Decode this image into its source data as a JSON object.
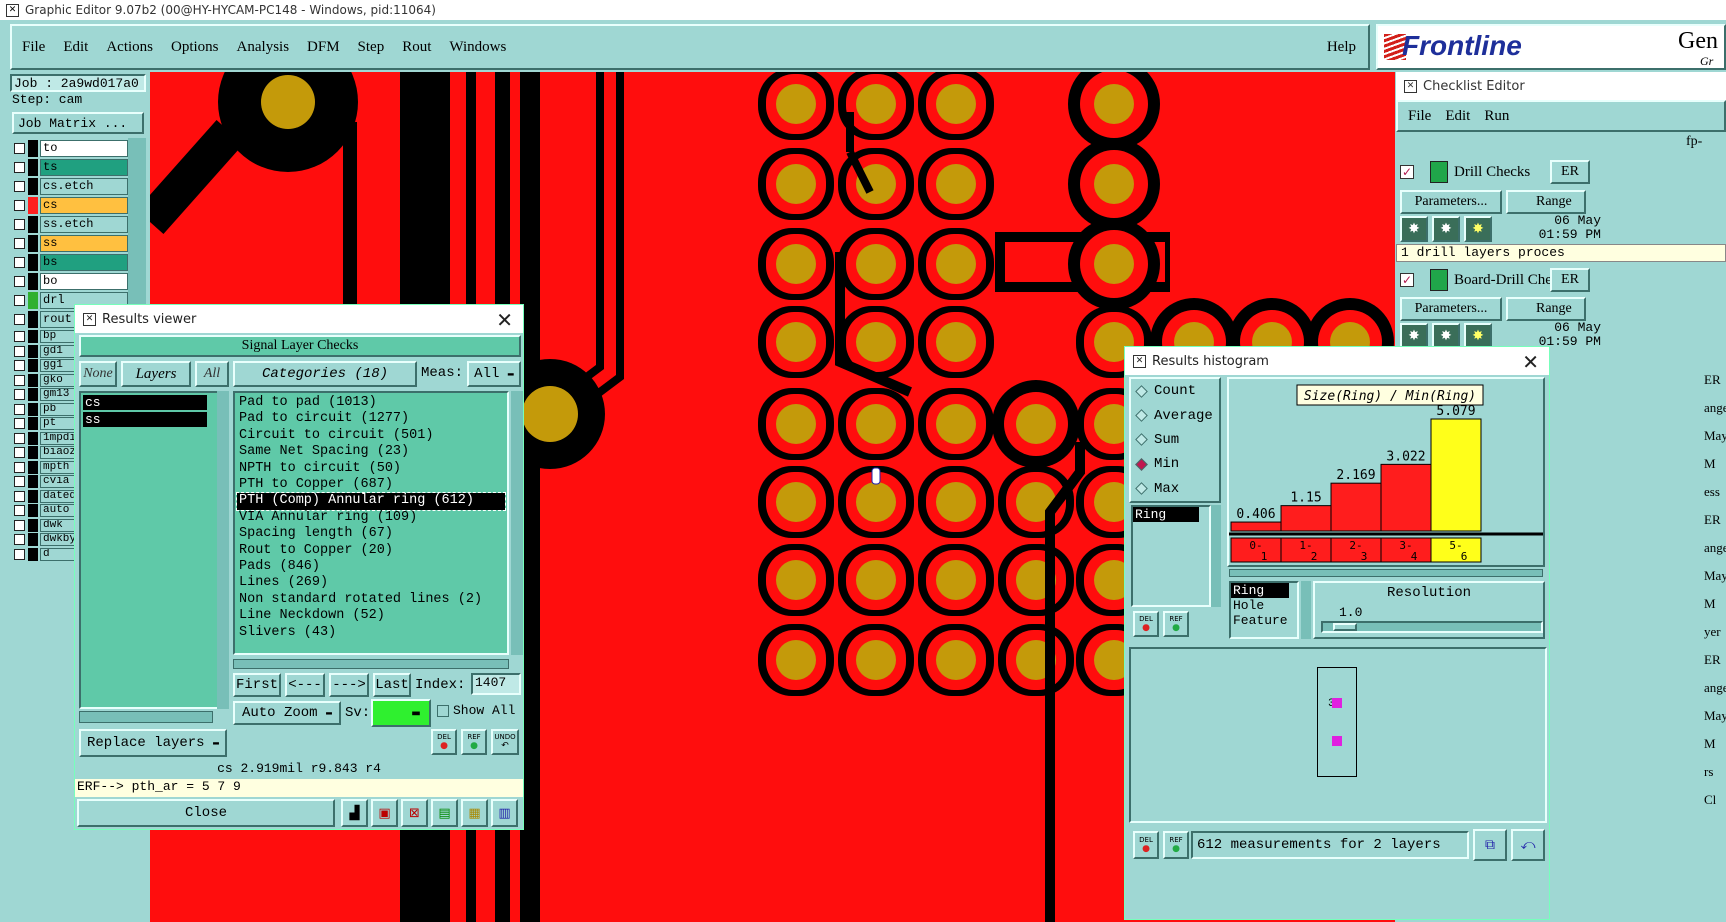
{
  "titlebar": {
    "title": "Graphic Editor 9.07b2 (00@HY-HYCAM-PC148 - Windows, pid:11064)"
  },
  "menu": {
    "items": [
      "File",
      "Edit",
      "Actions",
      "Options",
      "Analysis",
      "DFM",
      "Step",
      "Rout",
      "Windows"
    ],
    "help": "Help"
  },
  "brand": {
    "logo": "Frontline",
    "right_text": "Gen",
    "sub": "Gr"
  },
  "left_panel": {
    "job": "Job : 2a9wd017a0",
    "step": "Step: cam",
    "job_matrix": "Job Matrix ...",
    "layers": [
      "to",
      "ts",
      "cs.etch",
      "cs",
      "ss.etch",
      "ss",
      "bs",
      "bo",
      "drl",
      "rout",
      "bp",
      "gd1",
      "gg1",
      "gko",
      "gm13",
      "pb",
      "pt",
      "1mpdi",
      "biaoz",
      "mpth",
      "cvia",
      "dated",
      "auto",
      "dwk",
      "dwkby",
      "d"
    ]
  },
  "results_viewer": {
    "title": "Results viewer",
    "header": "Signal Layer Checks",
    "none": "None",
    "layers": "Layers",
    "all": "All",
    "categories_btn": "Categories (18)",
    "meas_label": "Meas:",
    "meas_value": "All",
    "layer_list": [
      "cs",
      "ss"
    ],
    "categories": [
      "Pad to pad (1013)",
      "Pad to circuit (1277)",
      "Circuit to circuit (501)",
      "Same Net Spacing (23)",
      "NPTH to circuit (50)",
      "PTH to Copper (687)",
      "PTH (Comp) Annular ring (612)",
      "VIA Annular ring (109)",
      "Spacing length (67)",
      "Rout to Copper (20)",
      "Pads (846)",
      "Lines (269)",
      "Non standard rotated lines (2)",
      "Line Neckdown (52)",
      "Slivers (43)"
    ],
    "selected_category": "PTH (Comp) Annular ring (612)",
    "first": "First",
    "prev": "<---",
    "next": "--->",
    "last": "Last",
    "index_label": "Index:",
    "index_value": "1407",
    "auto_zoom": "Auto Zoom",
    "sv_label": "Sv:",
    "show_all": "Show All",
    "replace_layers": "Replace layers",
    "del": "DEL",
    "ref": "REF",
    "undo": "UNDO",
    "status": "cs 2.919mil  r9.843  r4",
    "erf": "ERF--> pth_ar = 5 7 9",
    "close": "Close"
  },
  "checklist": {
    "title": "Checklist Editor",
    "menu": [
      "File",
      "Edit",
      "Run"
    ],
    "fp": "fp-",
    "drill": "Drill Checks",
    "er": "ER",
    "params": "Parameters...",
    "range": "Range",
    "date": "06 May",
    "time": "01:59 PM",
    "drill_msg": "1 drill layers proces",
    "board": "Board-Drill Che",
    "side_fragments": [
      "ER",
      "ange",
      "May",
      "M",
      "ess",
      "ER",
      "ange",
      "May",
      "M",
      "yer",
      "ER",
      "ange",
      "May",
      "M",
      "rs",
      "Cl"
    ]
  },
  "histogram": {
    "title": "Results histogram",
    "options": [
      "Count",
      "Average",
      "Sum",
      "Min",
      "Max"
    ],
    "selected": "Min",
    "field": "Ring",
    "chart_title": "Size(Ring) / Min(Ring)",
    "bins": [
      "0-\n1",
      "1-\n2",
      "2-\n3",
      "3-\n4",
      "5-\n6"
    ],
    "values": [
      0.406,
      1.15,
      2.169,
      3.022,
      5.079
    ],
    "value_labels": [
      "0.406",
      "1.15",
      "2.169",
      "3.022",
      "5.079"
    ],
    "axis_list": [
      "Ring",
      "Hole",
      "Feature"
    ],
    "resolution_label": "Resolution",
    "resolution_value": "1.0",
    "measurement_text": "612 measurements for 2 layers",
    "del": "DEL",
    "ref": "REF",
    "box_digit": "3"
  },
  "chart_data": {
    "type": "bar",
    "title": "Size(Ring) / Min(Ring)",
    "categories": [
      "0-1",
      "1-2",
      "2-3",
      "3-4",
      "5-6"
    ],
    "values": [
      0.406,
      1.15,
      2.169,
      3.022,
      5.079
    ],
    "colors": [
      "#ff1d1d",
      "#ff1d1d",
      "#ff1d1d",
      "#ff1d1d",
      "#ffff1a"
    ]
  },
  "colors": {
    "copper": "#ff0d0d",
    "pad": "#c49a0a",
    "bg": "#9fd7d3",
    "accent": "#5fc9a8"
  }
}
